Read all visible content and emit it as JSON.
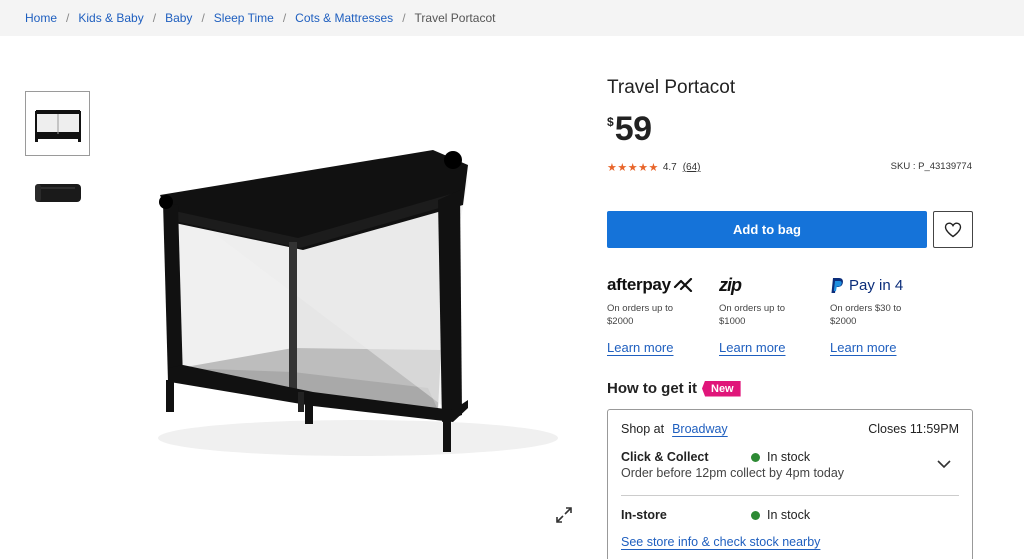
{
  "breadcrumb": {
    "items": [
      "Home",
      "Kids & Baby",
      "Baby",
      "Sleep Time",
      "Cots & Mattresses"
    ],
    "current": "Travel Portacot"
  },
  "product": {
    "title": "Travel Portacot",
    "currency": "$",
    "price": "59",
    "rating": "4.7",
    "review_count": "(64)",
    "stars": 5,
    "sku": "SKU : P_43139774"
  },
  "actions": {
    "add_to_bag": "Add to bag",
    "wishlist_icon": "heart-icon",
    "expand_icon": "expand-icon"
  },
  "payments": [
    {
      "name": "afterpay",
      "logo_text": "afterpay",
      "desc": "On orders up to $2000",
      "link": "Learn more"
    },
    {
      "name": "zip",
      "logo_text": "zip",
      "desc": "On orders up to $1000",
      "link": "Learn more"
    },
    {
      "name": "paypal",
      "logo_text": "Pay in 4",
      "desc": "On orders $30 to $2000",
      "link": "Learn more"
    }
  ],
  "delivery": {
    "title": "How to get it",
    "badge": "New",
    "shop_at": "Shop at",
    "store": "Broadway",
    "closes": "Closes 11:59PM",
    "click_collect": {
      "title": "Click & Collect",
      "stock": "In stock",
      "subtitle": "Order before 12pm collect by 4pm today"
    },
    "in_store": {
      "title": "In-store",
      "stock": "In stock"
    },
    "store_info_link": "See store info & check stock nearby"
  },
  "colors": {
    "accent": "#1573d9",
    "link": "#1f5fbf",
    "star": "#e8652a",
    "badge": "#e0167a",
    "in_stock": "#2d8a34"
  }
}
